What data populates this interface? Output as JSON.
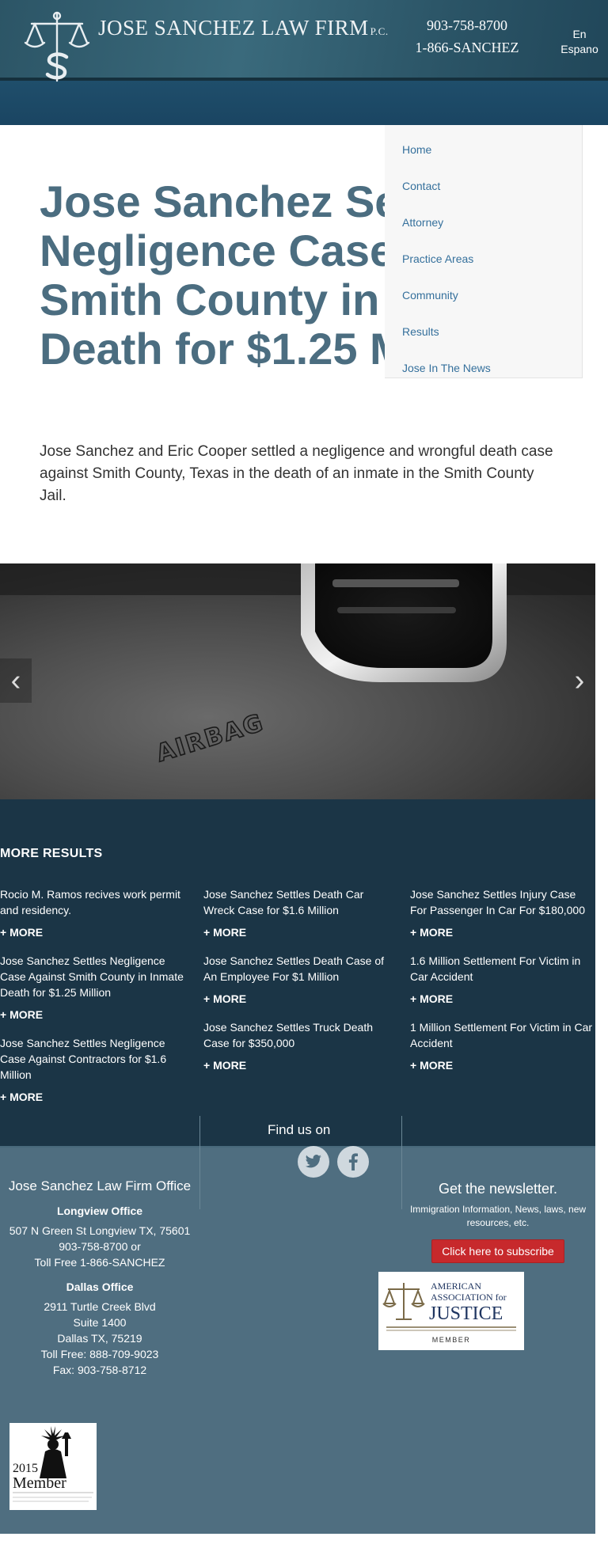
{
  "header": {
    "firm_name": "JOSE SANCHEZ LAW FIRM",
    "firm_suffix": "P.C.",
    "phone_1": "903-758-8700",
    "phone_2": "1-866-SANCHEZ",
    "lang_line1": "En",
    "lang_line2": "Espano"
  },
  "nav": {
    "items": [
      {
        "label": "Home"
      },
      {
        "label": "Contact"
      },
      {
        "label": "Attorney"
      },
      {
        "label": "Practice Areas"
      },
      {
        "label": "Community"
      },
      {
        "label": "Results"
      },
      {
        "label": "Jose In The News"
      }
    ]
  },
  "hero": {
    "title": "Jose Sanchez Settles Negligence Case Against Smith County in Inmate Death for $1.25 Million",
    "subtitle": "Jose Sanchez and Eric Cooper settled a negligence and wrongful death case against Smith County, Texas in the death of an inmate in the Smith County Jail."
  },
  "carousel": {
    "image_text": "AIRBAG",
    "prev_icon": "chevron-left-icon",
    "next_icon": "chevron-right-icon"
  },
  "results": {
    "title": "MORE RESULTS",
    "more_label": "+ MORE",
    "col1": [
      {
        "text": "Rocio M. Ramos recives work permit and residency."
      },
      {
        "text": "Jose Sanchez Settles Negligence Case Against Smith County in Inmate Death for $1.25 Million"
      },
      {
        "text": "Jose Sanchez Settles Negligence Case Against Contractors for $1.6 Million"
      }
    ],
    "col2": [
      {
        "text": "Jose Sanchez Settles Death Car Wreck Case for $1.6 Million"
      },
      {
        "text": "Jose Sanchez Settles Death Case of An Employee For $1 Million"
      },
      {
        "text": "Jose Sanchez Settles Truck Death Case for $350,000"
      }
    ],
    "col3": [
      {
        "text": "Jose Sanchez Settles Injury Case For Passenger In Car For $180,000"
      },
      {
        "text": "1.6 Million Settlement For Victim in Car Accident"
      },
      {
        "text": "1 Million Settlement For Victim in Car Accident"
      }
    ]
  },
  "social": {
    "find_us": "Find us on",
    "icons": [
      "twitter-icon",
      "facebook-icon"
    ]
  },
  "office": {
    "title": "Jose Sanchez Law Firm Office",
    "longview_heading": "Longview Office",
    "longview_address": "507 N Green St Longview TX, 75601",
    "longview_phone": "903-758-8700 or",
    "longview_tollfree": "Toll Free 1-866-SANCHEZ",
    "dallas_heading": "Dallas Office",
    "dallas_street": "2911 Turtle Creek Blvd",
    "dallas_suite": "Suite 1400",
    "dallas_city": "Dallas TX, 75219",
    "dallas_tollfree": "Toll Free: 888-709-9023",
    "dallas_fax": "Fax: 903-758-8712"
  },
  "newsletter": {
    "title": "Get the newsletter.",
    "text": "Immigration Information, News, laws, new resources, etc.",
    "button": "Click here to subscribe"
  },
  "badges": {
    "aaj_line1": "AMERICAN",
    "aaj_line2": "ASSOCIATION for",
    "aaj_line3": "JUSTICE",
    "aaj_member": "MEMBER",
    "year_badge_year": "2015",
    "year_badge_label": "Member"
  },
  "colors": {
    "title_blue": "#4b6d80",
    "results_bg": "#1b3546",
    "footer_bg": "#4f6e80",
    "subscribe_red": "#c7292c",
    "nav_link": "#35709c"
  }
}
